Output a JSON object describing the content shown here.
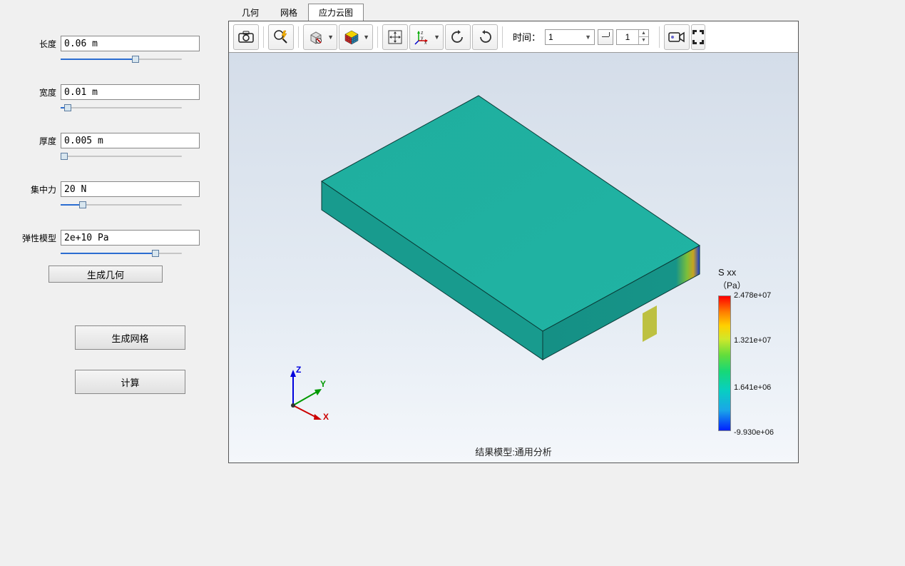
{
  "sidebar": {
    "params": [
      {
        "label": "长度",
        "value": "0.06 m",
        "slider_pct": 62
      },
      {
        "label": "宽度",
        "value": "0.01 m",
        "slider_pct": 6
      },
      {
        "label": "厚度",
        "value": "0.005 m",
        "slider_pct": 3
      },
      {
        "label": "集中力",
        "value": "20 N",
        "slider_pct": 18
      },
      {
        "label": "弹性模型",
        "value": "2e+10 Pa",
        "slider_pct": 78
      }
    ],
    "buttons": {
      "gen_geom": "生成几何",
      "gen_mesh": "生成网格",
      "compute": "计算"
    }
  },
  "tabs": {
    "items": [
      "几何",
      "网格",
      "应力云图"
    ],
    "active_index": 2
  },
  "toolbar": {
    "time_label": "时间：",
    "time_value": "1",
    "spin_value": "1"
  },
  "viewer": {
    "footer": "结果模型:通用分析",
    "axes": {
      "x": "X",
      "y": "Y",
      "z": "Z"
    }
  },
  "legend": {
    "title": "S xx",
    "unit": "（Pa）",
    "ticks": [
      {
        "pct": 0,
        "text": "2.478e+07"
      },
      {
        "pct": 33,
        "text": "1.321e+07"
      },
      {
        "pct": 67,
        "text": "1.641e+06"
      },
      {
        "pct": 100,
        "text": "-9.930e+06"
      }
    ]
  },
  "chart_data": {
    "type": "heatmap",
    "title": "结果模型:通用分析",
    "field": "S xx",
    "unit": "Pa",
    "colorbar_range": [
      -9930000.0,
      24780000.0
    ],
    "colorbar_ticks": [
      24780000.0,
      13210000.0,
      1641000.0,
      -9930000.0
    ],
    "geometry": {
      "type": "rectangular_beam",
      "length_m": 0.06,
      "width_m": 0.01,
      "thickness_m": 0.005
    },
    "load": {
      "type": "concentrated_force",
      "magnitude_N": 20
    },
    "material": {
      "elastic_modulus_Pa": 20000000000.0
    },
    "note": "Stress contour (S_xx) roughly uniform teal across beam with localized high-gradient (red/blue) region near far right end where load is applied."
  }
}
